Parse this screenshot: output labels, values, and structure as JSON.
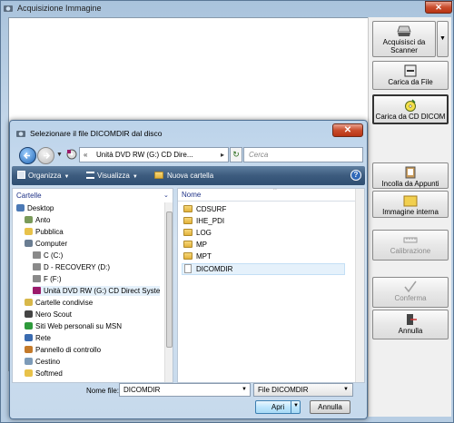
{
  "main": {
    "title": "Acquisizione Immagine",
    "buttons": [
      {
        "label": "Acquisisci da Scanner",
        "icon": "scanner-icon",
        "state": "normal"
      },
      {
        "label": "Carica da File",
        "icon": "file-load-icon",
        "state": "normal"
      },
      {
        "label": "Carica da CD DICOM",
        "icon": "cd-dicom-icon",
        "state": "active"
      },
      {
        "label": "Incolla da Appunti",
        "icon": "clipboard-icon",
        "state": "normal"
      },
      {
        "label": "Immagine interna",
        "icon": "folder-image-icon",
        "state": "normal"
      },
      {
        "label": "Calibrazione",
        "icon": "ruler-icon",
        "state": "disabled"
      },
      {
        "label": "Conferma",
        "icon": "checkmark-icon",
        "state": "disabled"
      },
      {
        "label": "Annulla",
        "icon": "exit-door-icon",
        "state": "normal"
      }
    ]
  },
  "dialog": {
    "title": "Selezionare il file DICOMDIR dal disco",
    "address": "Unità DVD RW (G:) CD Dire...",
    "search_placeholder": "Cerca",
    "toolbar": {
      "organize": "Organizza",
      "views": "Visualizza",
      "new_folder": "Nuova cartella"
    },
    "left_header": "Cartelle",
    "tree": [
      {
        "label": "Desktop",
        "icon": "desktop-icon",
        "indent": 0
      },
      {
        "label": "Anto",
        "icon": "user-folder-icon",
        "indent": 1
      },
      {
        "label": "Pubblica",
        "icon": "folder-icon",
        "indent": 1
      },
      {
        "label": "Computer",
        "icon": "computer-icon",
        "indent": 1
      },
      {
        "label": "C (C:)",
        "icon": "drive-icon",
        "indent": 2
      },
      {
        "label": "D - RECOVERY (D:)",
        "icon": "drive-icon",
        "indent": 2
      },
      {
        "label": "F (F:)",
        "icon": "drive-icon",
        "indent": 2
      },
      {
        "label": "Unità DVD RW (G:) CD Direct Syste",
        "icon": "dvd-icon",
        "indent": 2
      },
      {
        "label": "Cartelle condivise",
        "icon": "shared-folder-icon",
        "indent": 1
      },
      {
        "label": "Nero Scout",
        "icon": "nero-icon",
        "indent": 1
      },
      {
        "label": "Siti Web personali su MSN",
        "icon": "msn-icon",
        "indent": 1
      },
      {
        "label": "Rete",
        "icon": "network-icon",
        "indent": 1
      },
      {
        "label": "Pannello di controllo",
        "icon": "control-panel-icon",
        "indent": 1
      },
      {
        "label": "Cestino",
        "icon": "recycle-bin-icon",
        "indent": 1
      },
      {
        "label": "Softmed",
        "icon": "folder-icon",
        "indent": 1
      }
    ],
    "right_header": "Nome",
    "files": [
      {
        "name": "CDSURF",
        "type": "folder"
      },
      {
        "name": "IHE_PDI",
        "type": "folder"
      },
      {
        "name": "LOG",
        "type": "folder"
      },
      {
        "name": "MP",
        "type": "folder"
      },
      {
        "name": "MPT",
        "type": "folder"
      },
      {
        "name": "DICOMDIR",
        "type": "file"
      }
    ],
    "filename_label": "Nome file:",
    "filename_value": "DICOMDIR",
    "filetype_value": "File DICOMDIR",
    "open_label": "Apri",
    "cancel_label": "Annulla"
  }
}
